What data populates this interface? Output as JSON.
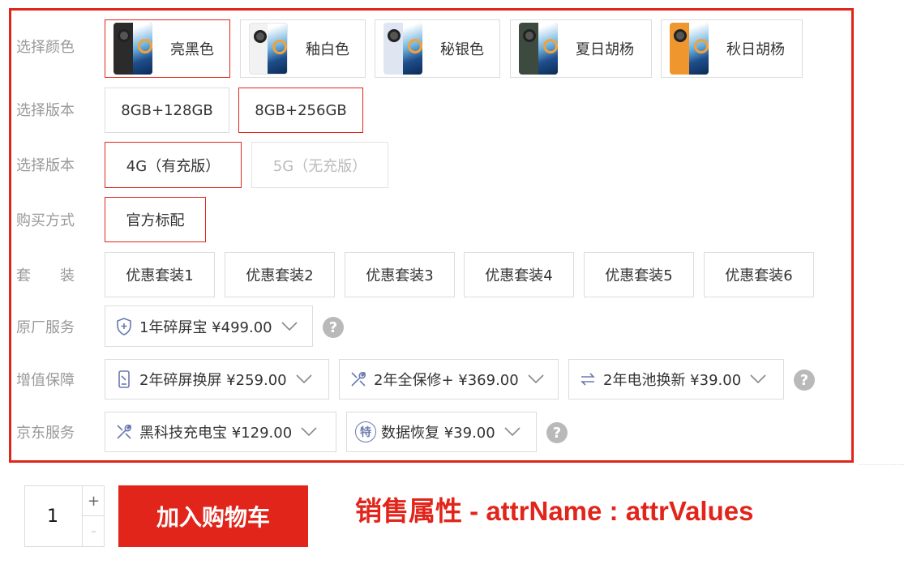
{
  "colors": {
    "accent": "#e1251b",
    "label": "#999999",
    "border": "#dcdcdc"
  },
  "rows": {
    "color": {
      "label": "选择颜色",
      "options": [
        {
          "label": "亮黑色",
          "selected": true,
          "body_color": "#2b2b2b"
        },
        {
          "label": "釉白色",
          "selected": false,
          "body_color": "#f2f2f2"
        },
        {
          "label": "秘银色",
          "selected": false,
          "body_color": "#dfe6f1"
        },
        {
          "label": "夏日胡杨",
          "selected": false,
          "body_color": "#3d4a40"
        },
        {
          "label": "秋日胡杨",
          "selected": false,
          "body_color": "#f0962e"
        }
      ]
    },
    "memory": {
      "label": "选择版本",
      "options": [
        {
          "label": "8GB+128GB",
          "selected": false
        },
        {
          "label": "8GB+256GB",
          "selected": true
        }
      ]
    },
    "network": {
      "label": "选择版本",
      "options": [
        {
          "label": "4G（有充版）",
          "selected": true
        },
        {
          "label": "5G（无充版）",
          "selected": false,
          "disabled": true
        }
      ]
    },
    "purchase": {
      "label": "购买方式",
      "options": [
        {
          "label": "官方标配",
          "selected": true
        }
      ]
    },
    "bundle": {
      "label": "套　　装",
      "options": [
        {
          "label": "优惠套装1"
        },
        {
          "label": "优惠套装2"
        },
        {
          "label": "优惠套装3"
        },
        {
          "label": "优惠套装4"
        },
        {
          "label": "优惠套装5"
        },
        {
          "label": "优惠套装6"
        }
      ]
    },
    "factory_service": {
      "label": "原厂服务",
      "options": [
        {
          "label": "1年碎屏宝 ¥499.00",
          "icon": "shield-plus-icon"
        }
      ]
    },
    "value_added": {
      "label": "增值保障",
      "options": [
        {
          "label": "2年碎屏换屏 ¥259.00",
          "icon": "phone-screen-icon"
        },
        {
          "label": "2年全保修+ ¥369.00",
          "icon": "tools-icon"
        },
        {
          "label": "2年电池换新 ¥39.00",
          "icon": "swap-arrows-icon"
        }
      ]
    },
    "jd_service": {
      "label": "京东服务",
      "options": [
        {
          "label": "黑科技充电宝 ¥129.00",
          "icon": "tools-icon"
        },
        {
          "label": "数据恢复 ¥39.00",
          "icon": "special-badge-icon",
          "icon_char": "特"
        }
      ]
    }
  },
  "help_glyph": "?",
  "quantity": {
    "value": "1",
    "plus": "+",
    "minus": "-"
  },
  "add_to_cart_label": "加入购物车",
  "annotation": "销售属性 - attrName : attrValues"
}
